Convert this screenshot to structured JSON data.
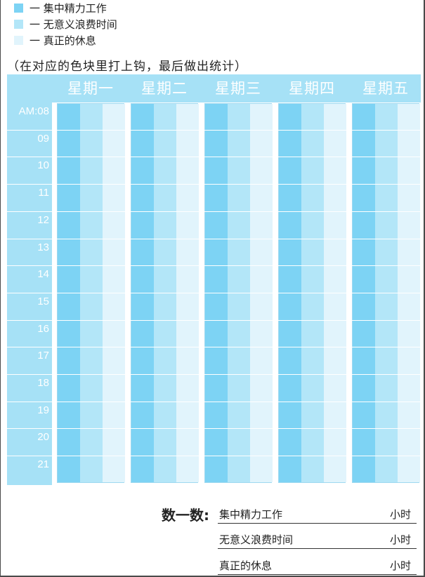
{
  "legend": [
    {
      "label": "一 集中精力工作",
      "color": "#7dd3f4"
    },
    {
      "label": "一 无意义浪费时间",
      "color": "#b3e6f8"
    },
    {
      "label": "一 真正的休息",
      "color": "#e1f4fc"
    }
  ],
  "instruction": "（在对应的色块里打上钩，最后做出统计）",
  "days": [
    "星期一",
    "星期二",
    "星期三",
    "星期四",
    "星期五"
  ],
  "times": [
    "AM:08",
    "09",
    "10",
    "11",
    "12",
    "13",
    "14",
    "15",
    "16",
    "17",
    "18",
    "19",
    "20",
    "21"
  ],
  "summary": {
    "title": "数一数:",
    "rows": [
      {
        "label": "集中精力工作",
        "unit": "小时"
      },
      {
        "label": "无意义浪费时间",
        "unit": "小时"
      },
      {
        "label": "真正的休息",
        "unit": "小时"
      }
    ]
  }
}
